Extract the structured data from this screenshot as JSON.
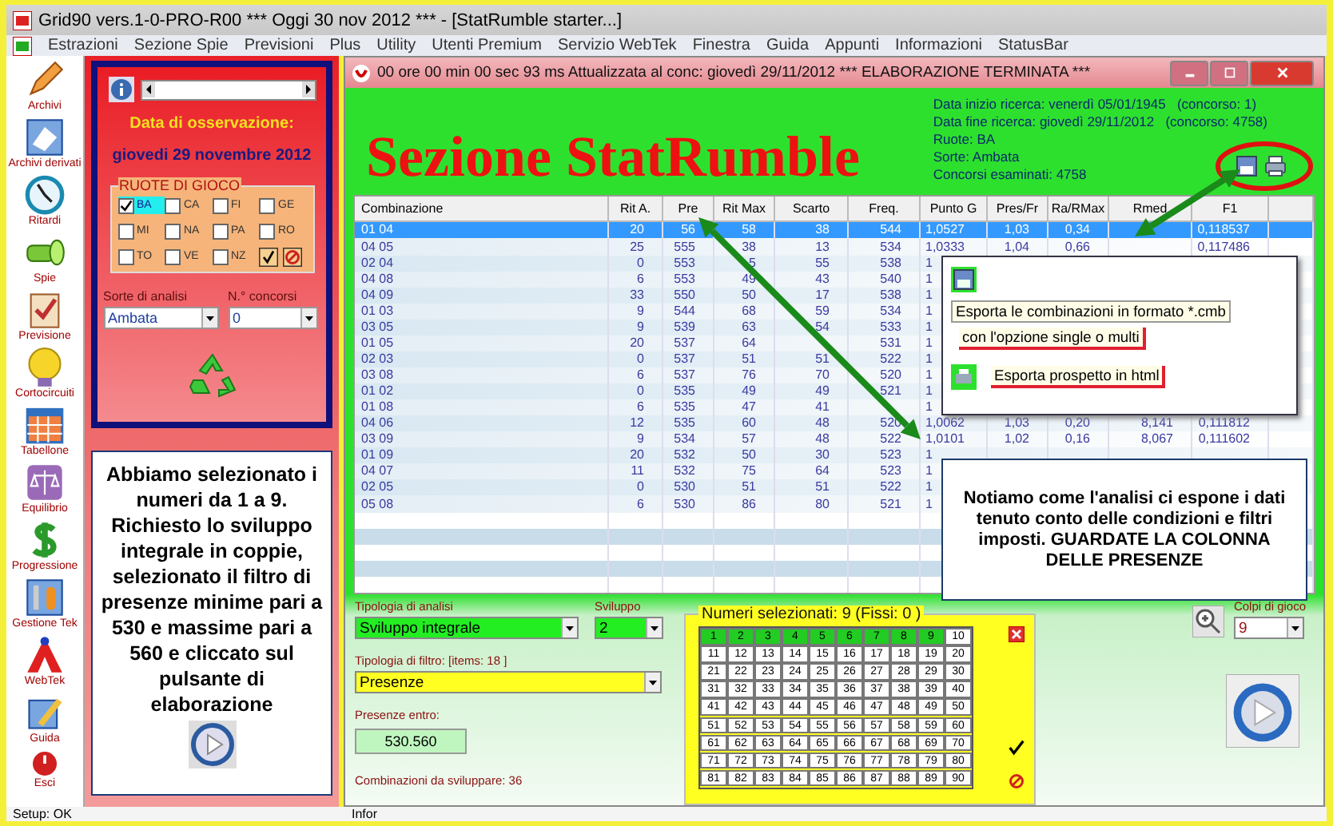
{
  "app_window": {
    "title": "Grid90 vers.1-0-PRO-R00  ***  Oggi 30 nov 2012  ***  - [StatRumble starter...]"
  },
  "menu": [
    "Estrazioni",
    "Sezione Spie",
    "Previsioni",
    "Plus",
    "Utility",
    "Utenti Premium",
    "Servizio WebTek",
    "Finestra",
    "Guida",
    "Appunti",
    "Informazioni",
    "StatusBar"
  ],
  "toolbar": [
    {
      "label": "Archivi",
      "kind": "pencil"
    },
    {
      "label": "Archivi derivati",
      "kind": "book"
    },
    {
      "label": "Ritardi",
      "kind": "clock"
    },
    {
      "label": "Spie",
      "kind": "flashlight"
    },
    {
      "label": "Previsione",
      "kind": "clipboard"
    },
    {
      "label": "Cortocircuiti",
      "kind": "bulb"
    },
    {
      "label": "Tabellone",
      "kind": "calendar"
    },
    {
      "label": "Equilibrio",
      "kind": "scale"
    },
    {
      "label": "Progressione",
      "kind": "dollar"
    },
    {
      "label": "Gestione Tek",
      "kind": "tools"
    },
    {
      "label": "WebTek",
      "kind": "triangle"
    },
    {
      "label": "Guida",
      "kind": "pen"
    },
    {
      "label": "Esci",
      "kind": "power"
    }
  ],
  "observation": {
    "label": "Data di osservazione:",
    "date": "giovedi 29 novembre 2012"
  },
  "ruote": {
    "title": "RUOTE DI GIOCO",
    "items": [
      {
        "label": "BA",
        "checked": true
      },
      {
        "label": "CA",
        "checked": false
      },
      {
        "label": "FI",
        "checked": false
      },
      {
        "label": "GE",
        "checked": false
      },
      {
        "label": "MI",
        "checked": false
      },
      {
        "label": "NA",
        "checked": false
      },
      {
        "label": "PA",
        "checked": false
      },
      {
        "label": "RO",
        "checked": false
      },
      {
        "label": "TO",
        "checked": false
      },
      {
        "label": "VE",
        "checked": false
      },
      {
        "label": "NZ",
        "checked": false
      }
    ]
  },
  "sorte": {
    "label": "Sorte di analisi",
    "value": "Ambata"
  },
  "concorsi": {
    "label": "N.° concorsi",
    "value": "0"
  },
  "note_left": "Abbiamo selezionato i numeri da 1 a 9. Richiesto lo sviluppo integrale in coppie, selezionato il filtro di presenze minime pari a 530 e massime pari a 560 e cliccato sul pulsante di elaborazione",
  "status_bar": [
    "Setup: OK",
    "Infor"
  ],
  "child_window": {
    "title": "00 ore 00 min 00 sec 93 ms   Attualizzata al conc: giovedì 29/11/2012 *** ELABORAZIONE TERMINATA ***"
  },
  "heading": "Sezione StatRumble",
  "info": [
    "Data inizio ricerca: venerdì 05/01/1945   (concorso: 1)",
    "Data fine ricerca: giovedì 29/11/2012   (concorso: 4758)",
    "Ruote: BA",
    "Sorte: Ambata",
    "Concorsi esaminati: 4758"
  ],
  "table": {
    "columns": [
      "Combinazione",
      "Rit A.",
      "Pre",
      "Rit Max",
      "Scarto",
      "Freq.",
      "Punto G",
      "Pres/Fr",
      "Ra/RMax",
      "Rmed",
      "F1"
    ],
    "rows": [
      {
        "selected": true,
        "cells": [
          "01 04",
          "20",
          "56",
          "58",
          "38",
          "544",
          "1,0527",
          "1,03",
          "0,34",
          null,
          "0,118537"
        ]
      },
      {
        "selected": false,
        "cells": [
          "04 05",
          "25",
          "555",
          "38",
          "13",
          "534",
          "1,0333",
          "1,04",
          "0,66",
          null,
          "0,117486"
        ]
      },
      {
        "selected": false,
        "cells": [
          "02 04",
          "0",
          "553",
          "5",
          "55",
          "538",
          "1",
          null,
          null,
          null,
          null
        ]
      },
      {
        "selected": false,
        "cells": [
          "04 08",
          "6",
          "553",
          "49",
          "43",
          "540",
          "1",
          null,
          null,
          null,
          null
        ]
      },
      {
        "selected": false,
        "cells": [
          "04 09",
          "33",
          "550",
          "50",
          "17",
          "538",
          "1",
          null,
          null,
          null,
          null
        ]
      },
      {
        "selected": false,
        "cells": [
          "01 03",
          "9",
          "544",
          "68",
          "59",
          "534",
          "1",
          null,
          null,
          null,
          null
        ]
      },
      {
        "selected": false,
        "cells": [
          "03 05",
          "9",
          "539",
          "63",
          "54",
          "533",
          "1",
          null,
          null,
          null,
          null
        ]
      },
      {
        "selected": false,
        "cells": [
          "01 05",
          "20",
          "537",
          "64",
          null,
          "531",
          "1",
          null,
          null,
          null,
          null
        ]
      },
      {
        "selected": false,
        "cells": [
          "02 03",
          "0",
          "537",
          "51",
          "51",
          "522",
          "1",
          null,
          null,
          null,
          null
        ]
      },
      {
        "selected": false,
        "cells": [
          "03 08",
          "6",
          "537",
          "76",
          "70",
          "520",
          "1",
          null,
          null,
          null,
          null
        ]
      },
      {
        "selected": false,
        "cells": [
          "01 02",
          "0",
          "535",
          "49",
          "49",
          "521",
          "1",
          null,
          null,
          null,
          null
        ]
      },
      {
        "selected": false,
        "cells": [
          "01 08",
          "6",
          "535",
          "47",
          "41",
          null,
          "1",
          null,
          null,
          null,
          null
        ]
      },
      {
        "selected": false,
        "cells": [
          "04 06",
          "12",
          "535",
          "60",
          "48",
          "520",
          "1,0062",
          "1,03",
          "0,20",
          "8,141",
          "0,111812"
        ]
      },
      {
        "selected": false,
        "cells": [
          "03 09",
          "9",
          "534",
          "57",
          "48",
          "522",
          "1,0101",
          "1,02",
          "0,16",
          "8,067",
          "0,111602"
        ]
      },
      {
        "selected": false,
        "cells": [
          "01 09",
          "20",
          "532",
          "50",
          "30",
          "523",
          "1",
          null,
          null,
          null,
          null
        ]
      },
      {
        "selected": false,
        "cells": [
          "04 07",
          "11",
          "532",
          "75",
          "64",
          "523",
          "1",
          null,
          null,
          null,
          null
        ]
      },
      {
        "selected": false,
        "cells": [
          "02 05",
          "0",
          "530",
          "51",
          "51",
          "522",
          "1",
          null,
          null,
          null,
          null
        ]
      },
      {
        "selected": false,
        "cells": [
          "05 08",
          "6",
          "530",
          "86",
          "80",
          "521",
          "1",
          null,
          null,
          null,
          null
        ]
      }
    ]
  },
  "popup": {
    "items": [
      "Esporta le combinazioni in formato *.cmb",
      "con l'opzione single o multi",
      "Esporta prospetto in html"
    ]
  },
  "note_right": "Notiamo come l'analisi ci espone i dati tenuto conto delle condizioni e filtri imposti. GUARDATE LA COLONNA DELLE PRESENZE",
  "analysis": {
    "label": "Tipologia di analisi",
    "value": "Sviluppo integrale"
  },
  "sviluppo": {
    "label": "Sviluppo",
    "value": "2"
  },
  "filter": {
    "label": "Tipologia di filtro: [items: 18 ]",
    "value": "Presenze"
  },
  "presenze": {
    "label": "Presenze entro:",
    "value": "530.560"
  },
  "combinations": "Combinazioni da sviluppare: 36",
  "grid": {
    "title": "Numeri selezionati: 9 (Fissi: 0 )",
    "numbers": [
      {
        "n": "1",
        "selected": true
      },
      {
        "n": "2",
        "selected": true
      },
      {
        "n": "3",
        "selected": true
      },
      {
        "n": "4",
        "selected": true
      },
      {
        "n": "5",
        "selected": true
      },
      {
        "n": "6",
        "selected": true
      },
      {
        "n": "7",
        "selected": true
      },
      {
        "n": "8",
        "selected": true
      },
      {
        "n": "9",
        "selected": true
      },
      {
        "n": "10",
        "selected": false
      },
      {
        "n": "11",
        "selected": false
      },
      {
        "n": "12",
        "selected": false
      },
      {
        "n": "13",
        "selected": false
      },
      {
        "n": "14",
        "selected": false
      },
      {
        "n": "15",
        "selected": false
      },
      {
        "n": "16",
        "selected": false
      },
      {
        "n": "17",
        "selected": false
      },
      {
        "n": "18",
        "selected": false
      },
      {
        "n": "19",
        "selected": false
      },
      {
        "n": "20",
        "selected": false
      },
      {
        "n": "21",
        "selected": false
      },
      {
        "n": "22",
        "selected": false
      },
      {
        "n": "23",
        "selected": false
      },
      {
        "n": "24",
        "selected": false
      },
      {
        "n": "25",
        "selected": false
      },
      {
        "n": "26",
        "selected": false
      },
      {
        "n": "27",
        "selected": false
      },
      {
        "n": "28",
        "selected": false
      },
      {
        "n": "29",
        "selected": false
      },
      {
        "n": "30",
        "selected": false
      },
      {
        "n": "31",
        "selected": false
      },
      {
        "n": "32",
        "selected": false
      },
      {
        "n": "33",
        "selected": false
      },
      {
        "n": "34",
        "selected": false
      },
      {
        "n": "35",
        "selected": false
      },
      {
        "n": "36",
        "selected": false
      },
      {
        "n": "37",
        "selected": false
      },
      {
        "n": "38",
        "selected": false
      },
      {
        "n": "39",
        "selected": false
      },
      {
        "n": "40",
        "selected": false
      },
      {
        "n": "41",
        "selected": false
      },
      {
        "n": "42",
        "selected": false
      },
      {
        "n": "43",
        "selected": false
      },
      {
        "n": "44",
        "selected": false
      },
      {
        "n": "45",
        "selected": false
      },
      {
        "n": "46",
        "selected": false
      },
      {
        "n": "47",
        "selected": false
      },
      {
        "n": "48",
        "selected": false
      },
      {
        "n": "49",
        "selected": false
      },
      {
        "n": "50",
        "selected": false
      },
      {
        "n": "51",
        "selected": false
      },
      {
        "n": "52",
        "selected": false
      },
      {
        "n": "53",
        "selected": false
      },
      {
        "n": "54",
        "selected": false
      },
      {
        "n": "55",
        "selected": false
      },
      {
        "n": "56",
        "selected": false
      },
      {
        "n": "57",
        "selected": false
      },
      {
        "n": "58",
        "selected": false
      },
      {
        "n": "59",
        "selected": false
      },
      {
        "n": "60",
        "selected": false
      },
      {
        "n": "61",
        "selected": false
      },
      {
        "n": "62",
        "selected": false
      },
      {
        "n": "63",
        "selected": false
      },
      {
        "n": "64",
        "selected": false
      },
      {
        "n": "65",
        "selected": false
      },
      {
        "n": "66",
        "selected": false
      },
      {
        "n": "67",
        "selected": false
      },
      {
        "n": "68",
        "selected": false
      },
      {
        "n": "69",
        "selected": false
      },
      {
        "n": "70",
        "selected": false
      },
      {
        "n": "71",
        "selected": false
      },
      {
        "n": "72",
        "selected": false
      },
      {
        "n": "73",
        "selected": false
      },
      {
        "n": "74",
        "selected": false
      },
      {
        "n": "75",
        "selected": false
      },
      {
        "n": "76",
        "selected": false
      },
      {
        "n": "77",
        "selected": false
      },
      {
        "n": "78",
        "selected": false
      },
      {
        "n": "79",
        "selected": false
      },
      {
        "n": "80",
        "selected": false
      },
      {
        "n": "81",
        "selected": false
      },
      {
        "n": "82",
        "selected": false
      },
      {
        "n": "83",
        "selected": false
      },
      {
        "n": "84",
        "selected": false
      },
      {
        "n": "85",
        "selected": false
      },
      {
        "n": "86",
        "selected": false
      },
      {
        "n": "87",
        "selected": false
      },
      {
        "n": "88",
        "selected": false
      },
      {
        "n": "89",
        "selected": false
      },
      {
        "n": "90",
        "selected": false
      }
    ]
  },
  "colpi": {
    "label": "Colpi di gioco",
    "value": "9"
  }
}
